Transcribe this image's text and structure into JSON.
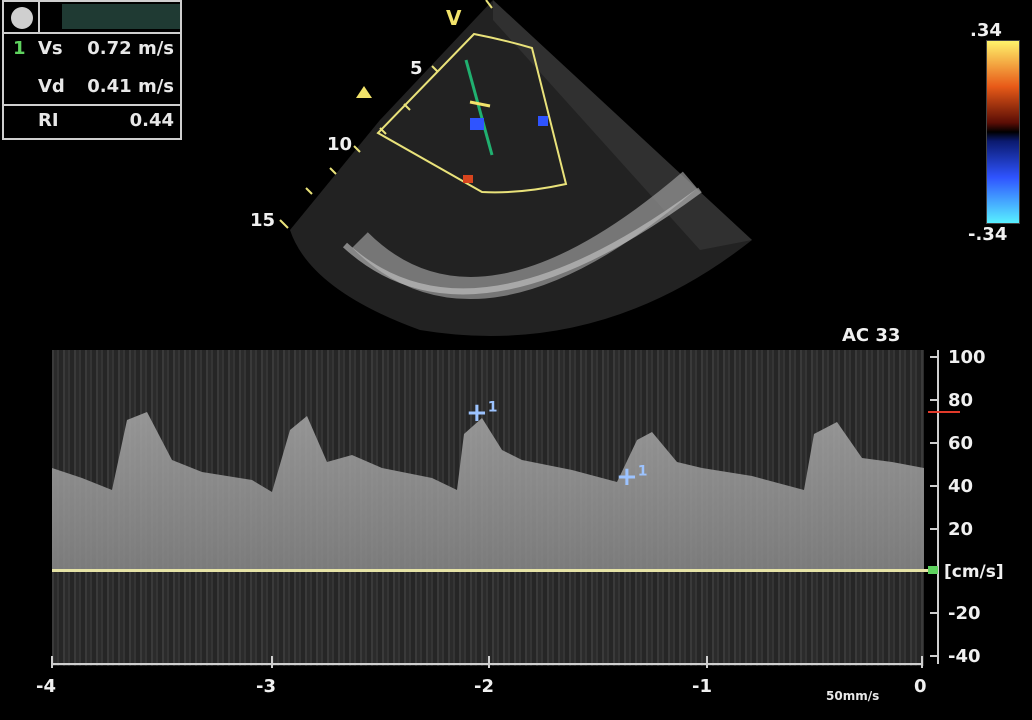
{
  "measurements": {
    "mode_label": "",
    "rows": [
      {
        "index": "1",
        "label": "Vs",
        "value": "0.72 m/s"
      },
      {
        "index": "",
        "label": "Vd",
        "value": "0.41 m/s"
      },
      {
        "index": "",
        "label": "RI",
        "value": "0.44"
      }
    ]
  },
  "image": {
    "orientation_marker": "V",
    "depth_labels": [
      "5",
      "10",
      "15"
    ]
  },
  "color_scale": {
    "top_label": ".34",
    "bottom_label": "-.34",
    "colors": [
      "#fff36b",
      "#e85a18",
      "#5a0d05",
      "#000000",
      "#0b1a6e",
      "#2f54ff",
      "#58f0ff"
    ]
  },
  "doppler": {
    "gain_label": "AC 33",
    "y_ticks": [
      "100",
      "80",
      "60",
      "40",
      "20",
      "-20",
      "-40"
    ],
    "unit_label": "[cm/s]",
    "x_ticks": [
      "-4",
      "-3",
      "-2",
      "-1",
      "0"
    ],
    "sweep_speed": "50mm/s",
    "markers": [
      {
        "label": "+",
        "index": "1"
      },
      {
        "label": "+",
        "index": "1"
      }
    ]
  }
}
